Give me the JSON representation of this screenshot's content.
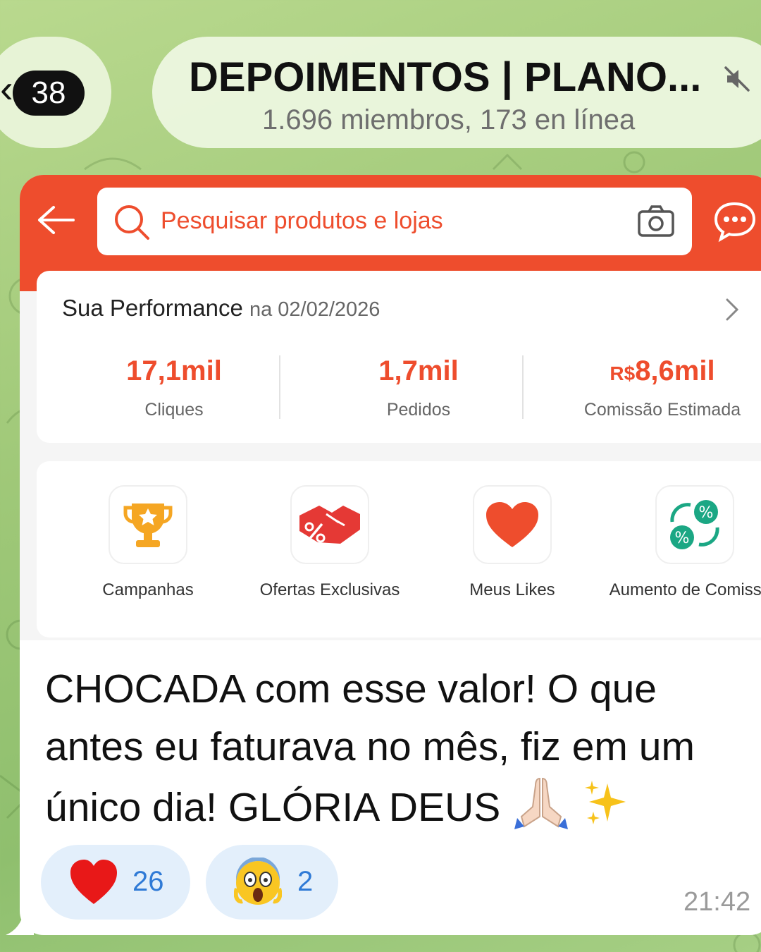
{
  "header": {
    "unread_count": "38",
    "chat_title": "DEPOIMENTOS | PLANO...",
    "chat_subtitle": "1.696 miembros, 173 en línea",
    "muted": true
  },
  "shop": {
    "search_placeholder": "Pesquisar produtos e lojas",
    "performance": {
      "title": "Sua Performance",
      "date": "na 02/02/2026",
      "metrics": [
        {
          "currency": "",
          "value": "17,1mil",
          "label": "Cliques"
        },
        {
          "currency": "",
          "value": "1,7mil",
          "label": "Pedidos"
        },
        {
          "currency": "R$",
          "value": "8,6mil",
          "label": "Comissão Estimada"
        }
      ]
    },
    "menu": [
      {
        "label": "Campanhas",
        "icon": "trophy-icon"
      },
      {
        "label": "Ofertas Exclusivas",
        "icon": "handshake-percent-icon"
      },
      {
        "label": "Meus Likes",
        "icon": "heart-icon"
      },
      {
        "label": "Aumento de Comissão",
        "icon": "percent-exchange-icon"
      }
    ]
  },
  "message": {
    "line1": "CHOCADA com esse valor! O que",
    "line2": "antes eu faturava no mês, fiz em um",
    "line3": "único dia! GLÓRIA DEUS",
    "emojis": [
      "🙏🏻",
      "✨"
    ],
    "time": "21:42"
  },
  "reactions": [
    {
      "emoji": "red-heart",
      "count": "26"
    },
    {
      "emoji": "scream-face",
      "count": "2"
    }
  ],
  "colors": {
    "shopee_orange": "#ee4d2d",
    "reaction_bg": "#e3effb",
    "reaction_text": "#2f7ad6"
  }
}
